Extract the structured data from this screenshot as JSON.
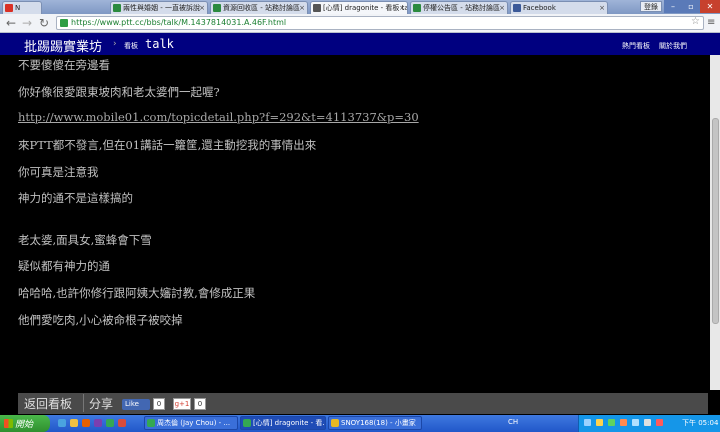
{
  "browser": {
    "tabs": [
      {
        "label": "N",
        "icon": "gmail-icon"
      },
      {
        "label": "兩性與婚姻 - 一直被訴說",
        "icon": "forum-icon"
      },
      {
        "label": "資源回收區 - 站務討論區",
        "icon": "forum-icon"
      },
      {
        "label": "[心情] dragonite - 看板 talk",
        "icon": "ptt-icon",
        "active": true
      },
      {
        "label": "停權公告區 - 站務討論區",
        "icon": "forum-icon"
      },
      {
        "label": "Facebook",
        "icon": "facebook-icon"
      }
    ],
    "signin_label": "登錄",
    "url": "https://www.ptt.cc/bbs/talk/M.1437814031.A.46F.html"
  },
  "header": {
    "site_title": "批踢踢實業坊",
    "crumb_sep": "›",
    "crumb_label": "看板",
    "board_name": "talk",
    "link_hot": "熱門看板",
    "link_about": "關於我們"
  },
  "content": {
    "lines": [
      {
        "text": "不要傻傻在旁邊看"
      },
      {
        "text": "你好像很愛跟東坡肉和老太婆們一起喔?"
      },
      {
        "text": "http://www.mobile01.com/topicdetail.php?f=292&t=4113737&p=30",
        "link": true
      },
      {
        "text": "來PTT都不發言,但在01講話一籮筐,還主動挖我的事情出來"
      },
      {
        "text": "你可真是注意我"
      },
      {
        "text": "神力的通不是這樣搞的"
      },
      {
        "text": "老太婆,面具女,蜜蜂會下雪"
      },
      {
        "text": "疑似都有神力的通"
      },
      {
        "text": "哈哈哈,也許你修行跟阿姨大嬸討教,會修成正果"
      },
      {
        "text": "他們愛吃肉,小心被命根子被咬掉"
      }
    ]
  },
  "footer": {
    "back_label": "返回看板",
    "share_label": "分享",
    "fb_like_label": "Like",
    "fb_count": "0",
    "gplus_label": "g+1",
    "gplus_count": "0"
  },
  "taskbar": {
    "start_label": "開始",
    "tasks": [
      {
        "label": "周杰倫 (Jay Chou) - ..."
      },
      {
        "label": "[心情] dragonite - 看...",
        "active": true
      },
      {
        "label": "SNOY168(18) - 小畫家"
      }
    ],
    "lang": "CH",
    "clock": "下午 05:04"
  },
  "colors": {
    "header_bg": "#000080",
    "content_bg": "#000000",
    "text": "#c0c0c0"
  }
}
